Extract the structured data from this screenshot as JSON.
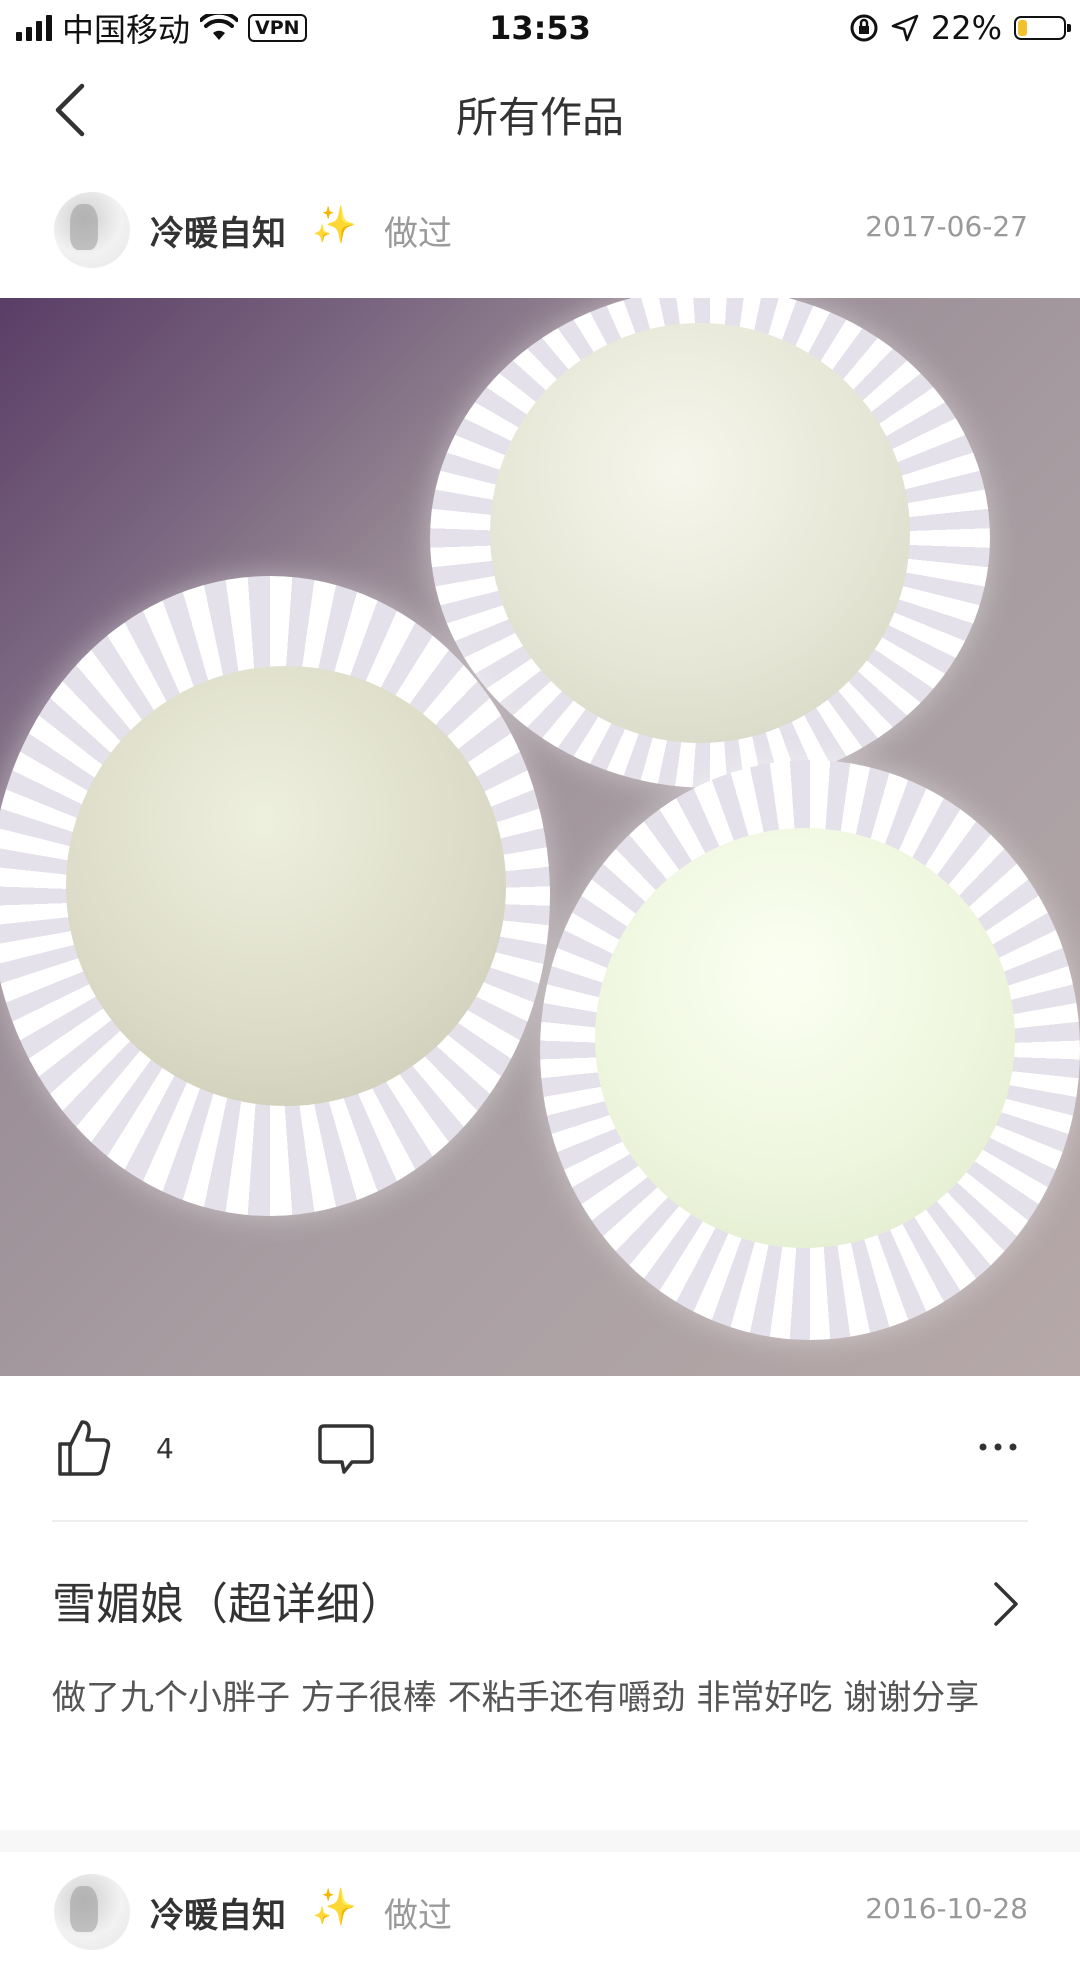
{
  "status_bar": {
    "carrier": "中国移动",
    "vpn": "VPN",
    "time": "13:53",
    "battery": "22%",
    "battery_level": 0.22
  },
  "nav": {
    "title": "所有作品"
  },
  "posts": [
    {
      "user": "冷暖自知",
      "emoji": "✨",
      "action": "做过",
      "date": "2017-06-27",
      "likes": "4",
      "recipe_title": "雪媚娘（超详细）",
      "comment": "做了九个小胖子 方子很棒 不粘手还有嚼劲 非常好吃 谢谢分享"
    },
    {
      "user": "冷暖自知",
      "emoji": "✨",
      "action": "做过",
      "date": "2016-10-28"
    }
  ],
  "colors": {
    "accent_sparkle": "#f3c544",
    "muted_text": "#999999",
    "divider": "#eeeeee"
  }
}
